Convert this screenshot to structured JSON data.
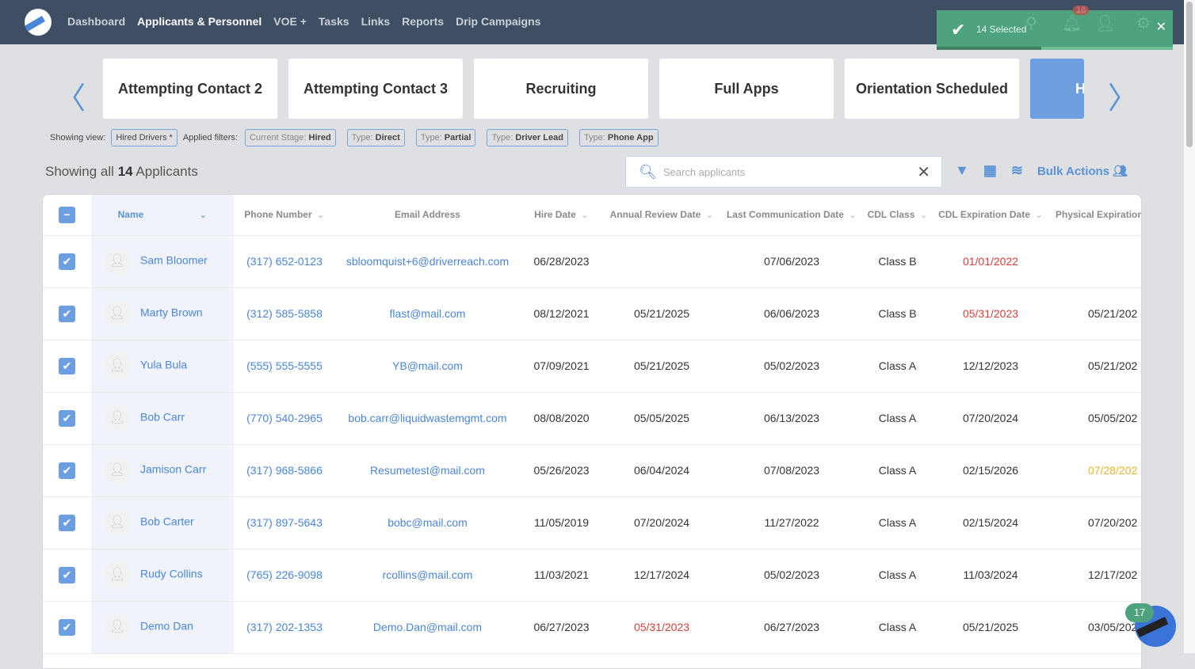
{
  "nav": {
    "items": [
      "Dashboard",
      "Applicants & Personnel",
      "VOE +",
      "Tasks",
      "Links",
      "Reports",
      "Drip Campaigns"
    ],
    "active": 1
  },
  "toast": {
    "text": "14 Selected",
    "notifications": "18"
  },
  "stages": [
    "Attempting Contact 2",
    "Attempting Contact 3",
    "Recruiting",
    "Full Apps",
    "Orientation Scheduled",
    "H"
  ],
  "filters": {
    "view_label": "Showing view:",
    "view": "Hired Drivers *",
    "applied_label": "Applied filters:",
    "chips": [
      {
        "k": "Current Stage:",
        "v": "Hired"
      },
      {
        "k": "Type:",
        "v": "Direct"
      },
      {
        "k": "Type:",
        "v": "Partial"
      },
      {
        "k": "Type:",
        "v": "Driver Lead"
      },
      {
        "k": "Type:",
        "v": "Phone App"
      }
    ]
  },
  "summary": {
    "prefix": "Showing all",
    "count": "14",
    "suffix": "Applicants"
  },
  "search": {
    "placeholder": "Search applicants",
    "value": ""
  },
  "bulk_actions": "Bulk Actions",
  "columns": [
    "Name",
    "Phone Number",
    "Email Address",
    "Hire Date",
    "Annual Review Date",
    "Last Communication Date",
    "CDL Class",
    "CDL Expiration Date",
    "Physical Expiration"
  ],
  "rows": [
    {
      "name": "Sam Bloomer",
      "phone": "(317) 652-0123",
      "email": "sbloomquist+6@driverreach.com",
      "hire": "06/28/2023",
      "review": "",
      "lastcomm": "07/06/2023",
      "cdl": "Class B",
      "cdlexp": "01/01/2022",
      "cdlexp_status": "expired",
      "phys": "",
      "phys_status": ""
    },
    {
      "name": "Marty Brown",
      "phone": "(312) 585-5858",
      "email": "flast@mail.com",
      "hire": "08/12/2021",
      "review": "05/21/2025",
      "lastcomm": "06/06/2023",
      "cdl": "Class B",
      "cdlexp": "05/31/2023",
      "cdlexp_status": "expired",
      "phys": "05/21/202",
      "phys_status": ""
    },
    {
      "name": "Yula Bula",
      "phone": "(555) 555-5555",
      "email": "YB@mail.com",
      "hire": "07/09/2021",
      "review": "05/21/2025",
      "lastcomm": "05/02/2023",
      "cdl": "Class A",
      "cdlexp": "12/12/2023",
      "cdlexp_status": "",
      "phys": "05/21/202",
      "phys_status": ""
    },
    {
      "name": "Bob Carr",
      "phone": "(770) 540-2965",
      "email": "bob.carr@liquidwastemgmt.com",
      "hire": "08/08/2020",
      "review": "05/05/2025",
      "lastcomm": "06/13/2023",
      "cdl": "Class A",
      "cdlexp": "07/20/2024",
      "cdlexp_status": "",
      "phys": "05/05/202",
      "phys_status": ""
    },
    {
      "name": "Jamison Carr",
      "phone": "(317) 968-5866",
      "email": "Resumetest@mail.com",
      "hire": "05/26/2023",
      "review": "06/04/2024",
      "lastcomm": "07/08/2023",
      "cdl": "Class A",
      "cdlexp": "02/15/2026",
      "cdlexp_status": "",
      "phys": "07/28/202",
      "phys_status": "warning"
    },
    {
      "name": "Bob Carter",
      "phone": "(317) 897-5643",
      "email": "bobc@mail.com",
      "hire": "11/05/2019",
      "review": "07/20/2024",
      "lastcomm": "11/27/2022",
      "cdl": "Class A",
      "cdlexp": "02/15/2024",
      "cdlexp_status": "",
      "phys": "07/20/202",
      "phys_status": ""
    },
    {
      "name": "Rudy Collins",
      "phone": "(765) 226-9098",
      "email": "rcollins@mail.com",
      "hire": "11/03/2021",
      "review": "12/17/2024",
      "lastcomm": "05/02/2023",
      "cdl": "Class A",
      "cdlexp": "11/03/2024",
      "cdlexp_status": "",
      "phys": "12/17/202",
      "phys_status": ""
    },
    {
      "name": "Demo Dan",
      "phone": "(317) 202-1353",
      "email": "Demo.Dan@mail.com",
      "hire": "06/27/2023",
      "review": "05/31/2023",
      "review_status": "expired",
      "lastcomm": "06/27/2023",
      "cdl": "Class A",
      "cdlexp": "05/21/2025",
      "cdlexp_status": "",
      "phys": "03/05/202",
      "phys_status": ""
    }
  ],
  "chat_badge": "17",
  "colors": {
    "topbar": "#3e4f63",
    "accent": "#4a86d8",
    "toast": "#4ea37e",
    "expired": "#d9403a",
    "warning": "#f0b429"
  }
}
